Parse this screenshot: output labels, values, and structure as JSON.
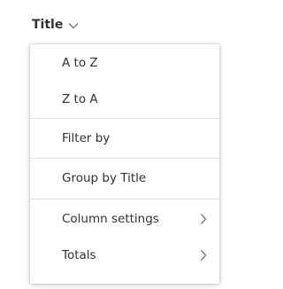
{
  "column_header": {
    "title": "Title",
    "dropdown_icon": "chevron-down-icon"
  },
  "menu": {
    "items": [
      {
        "label": "A to Z"
      },
      {
        "label": "Z to A"
      },
      {
        "label": "Filter by"
      },
      {
        "label": "Group by Title"
      },
      {
        "label": "Column settings",
        "submenu_icon": "chevron-right-icon"
      },
      {
        "label": "Totals",
        "submenu_icon": "chevron-right-icon"
      }
    ]
  },
  "colors": {
    "text": "#323130",
    "separator": "#e1dfdd",
    "chevron": "#605e5c"
  }
}
